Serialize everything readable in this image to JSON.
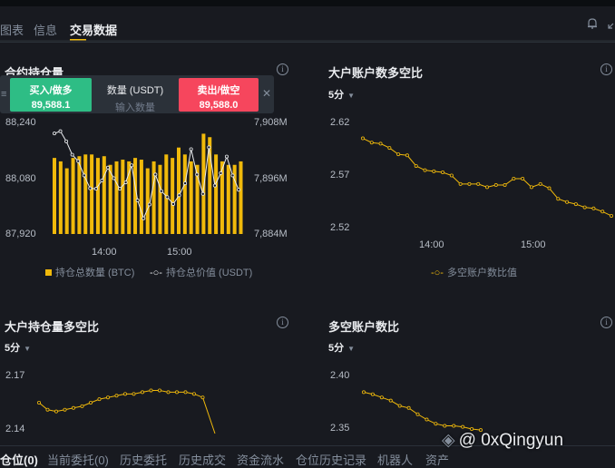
{
  "tabs": [
    {
      "label": "图表"
    },
    {
      "label": "信息"
    },
    {
      "label": "交易数据",
      "active": true
    }
  ],
  "open_interest": {
    "title": "合约持仓量",
    "trade": {
      "buy_label": "买入/做多",
      "buy_price": "89,588.1",
      "amount_label": "数量 (USDT)",
      "amount_placeholder": "输入数量",
      "sell_label": "卖出/做空",
      "sell_price": "89,588.0"
    },
    "left_ticks": [
      "88,240",
      "88,080",
      "87,920"
    ],
    "right_ticks": [
      "7,908M",
      "7,896M",
      "7,884M"
    ],
    "x_ticks": [
      "14:00",
      "15:00"
    ],
    "legend_bars": "持仓总数量 (BTC)",
    "legend_line": "持仓总价值 (USDT)"
  },
  "top_account_ratio": {
    "title": "大户账户数多空比",
    "interval": "5分",
    "y_ticks": [
      "2.62",
      "2.57",
      "2.52"
    ],
    "x_ticks": [
      "14:00",
      "15:00"
    ],
    "legend": "多空账户数比值"
  },
  "top_position_ratio": {
    "title": "大户持仓量多空比",
    "interval": "5分",
    "y_ticks": [
      "2.17",
      "2.14"
    ]
  },
  "account_ratio": {
    "title": "多空账户数比",
    "interval": "5分",
    "y_ticks": [
      "2.40",
      "2.35"
    ]
  },
  "bottom_tabs": [
    "仓位(0)",
    "当前委托(0)",
    "历史委托",
    "历史成交",
    "资金流水",
    "仓位历史记录",
    "机器人",
    "资产"
  ],
  "watermark": "@ 0xQingyun",
  "colors": {
    "accent": "#f0b90b",
    "buy": "#2ebd85",
    "sell": "#f6465d",
    "background": "#181a20"
  },
  "chart_data": [
    {
      "type": "bar",
      "title": "合约持仓量",
      "x_ticks": [
        "14:00",
        "15:00"
      ],
      "series": [
        {
          "name": "持仓总数量 (BTC)",
          "axis": "left",
          "values": [
            88140,
            88130,
            88110,
            88140,
            88145,
            88150,
            88150,
            88140,
            88145,
            88120,
            88130,
            88135,
            88130,
            88140,
            88135,
            88110,
            88130,
            88120,
            88150,
            88140,
            88170,
            88150,
            88130,
            88120,
            88210,
            88200,
            88150,
            88130,
            88120,
            88120,
            88130
          ]
        },
        {
          "name": "持仓总价值 (USDT)",
          "axis": "right",
          "values": [
            7905.8,
            7906.3,
            7904.1,
            7901.2,
            7899.8,
            7896.7,
            7893.9,
            7893.8,
            7895.6,
            7898.4,
            7896.1,
            7893.8,
            7895.2,
            7898.9,
            7891.3,
            7887.4,
            7890.4,
            7896.9,
            7893.3,
            7892.0,
            7890.5,
            7892.4,
            7895.0,
            7902.4,
            7896.9,
            7892.7,
            7902.8,
            7894.5,
            7897.2,
            7900.8,
            7896.7,
            7893.6
          ]
        }
      ],
      "ylim_left": [
        87920,
        88240
      ],
      "ylim_right": [
        7884,
        7908
      ],
      "right_unit": "M"
    },
    {
      "type": "line",
      "title": "大户账户数多空比",
      "x_ticks": [
        "14:00",
        "15:00"
      ],
      "series": [
        {
          "name": "多空账户数比值",
          "values": [
            2.605,
            2.601,
            2.6,
            2.596,
            2.59,
            2.589,
            2.579,
            2.575,
            2.574,
            2.573,
            2.57,
            2.562,
            2.562,
            2.562,
            2.559,
            2.561,
            2.561,
            2.567,
            2.567,
            2.559,
            2.562,
            2.558,
            2.548,
            2.545,
            2.543,
            2.54,
            2.539,
            2.536,
            2.532
          ]
        }
      ],
      "ylim": [
        2.52,
        2.62
      ]
    },
    {
      "type": "line",
      "title": "大户持仓量多空比",
      "series": [
        {
          "values": [
            2.155,
            2.151,
            2.15,
            2.151,
            2.152,
            2.153,
            2.155,
            2.157,
            2.158,
            2.159,
            2.16,
            2.16,
            2.161,
            2.162,
            2.162,
            2.161,
            2.161,
            2.161,
            2.16,
            2.158,
            2.139
          ]
        }
      ],
      "ylim": [
        2.14,
        2.17
      ]
    },
    {
      "type": "line",
      "title": "多空账户数比",
      "series": [
        {
          "values": [
            2.385,
            2.383,
            2.38,
            2.377,
            2.372,
            2.37,
            2.364,
            2.359,
            2.355,
            2.353,
            2.353,
            2.352,
            2.35,
            2.349
          ]
        }
      ],
      "ylim": [
        2.35,
        2.4
      ]
    }
  ]
}
